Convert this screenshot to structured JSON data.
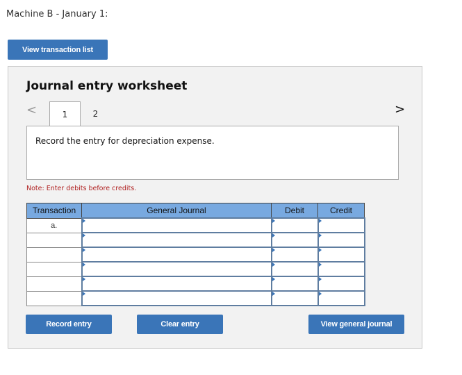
{
  "header": {
    "title": "Machine B - January 1:"
  },
  "buttons": {
    "view_transaction_list": "View transaction list",
    "record_entry": "Record entry",
    "clear_entry": "Clear entry",
    "view_general_journal": "View general journal"
  },
  "worksheet": {
    "title": "Journal entry worksheet",
    "tabs": [
      {
        "label": "1",
        "active": true
      },
      {
        "label": "2",
        "active": false
      }
    ],
    "prev_glyph": "<",
    "next_glyph": ">",
    "instruction": "Record the entry for depreciation expense.",
    "note": "Note: Enter debits before credits."
  },
  "journal_table": {
    "headers": [
      "Transaction",
      "General Journal",
      "Debit",
      "Credit"
    ],
    "rows": [
      {
        "transaction": "a.",
        "account": "",
        "debit": "",
        "credit": ""
      },
      {
        "transaction": "",
        "account": "",
        "debit": "",
        "credit": ""
      },
      {
        "transaction": "",
        "account": "",
        "debit": "",
        "credit": ""
      },
      {
        "transaction": "",
        "account": "",
        "debit": "",
        "credit": ""
      },
      {
        "transaction": "",
        "account": "",
        "debit": "",
        "credit": ""
      },
      {
        "transaction": "",
        "account": "",
        "debit": "",
        "credit": ""
      }
    ]
  },
  "colors": {
    "button": "#3a75b8",
    "header": "#78a9e0",
    "note": "#b02020",
    "panel": "#f2f2f2"
  }
}
